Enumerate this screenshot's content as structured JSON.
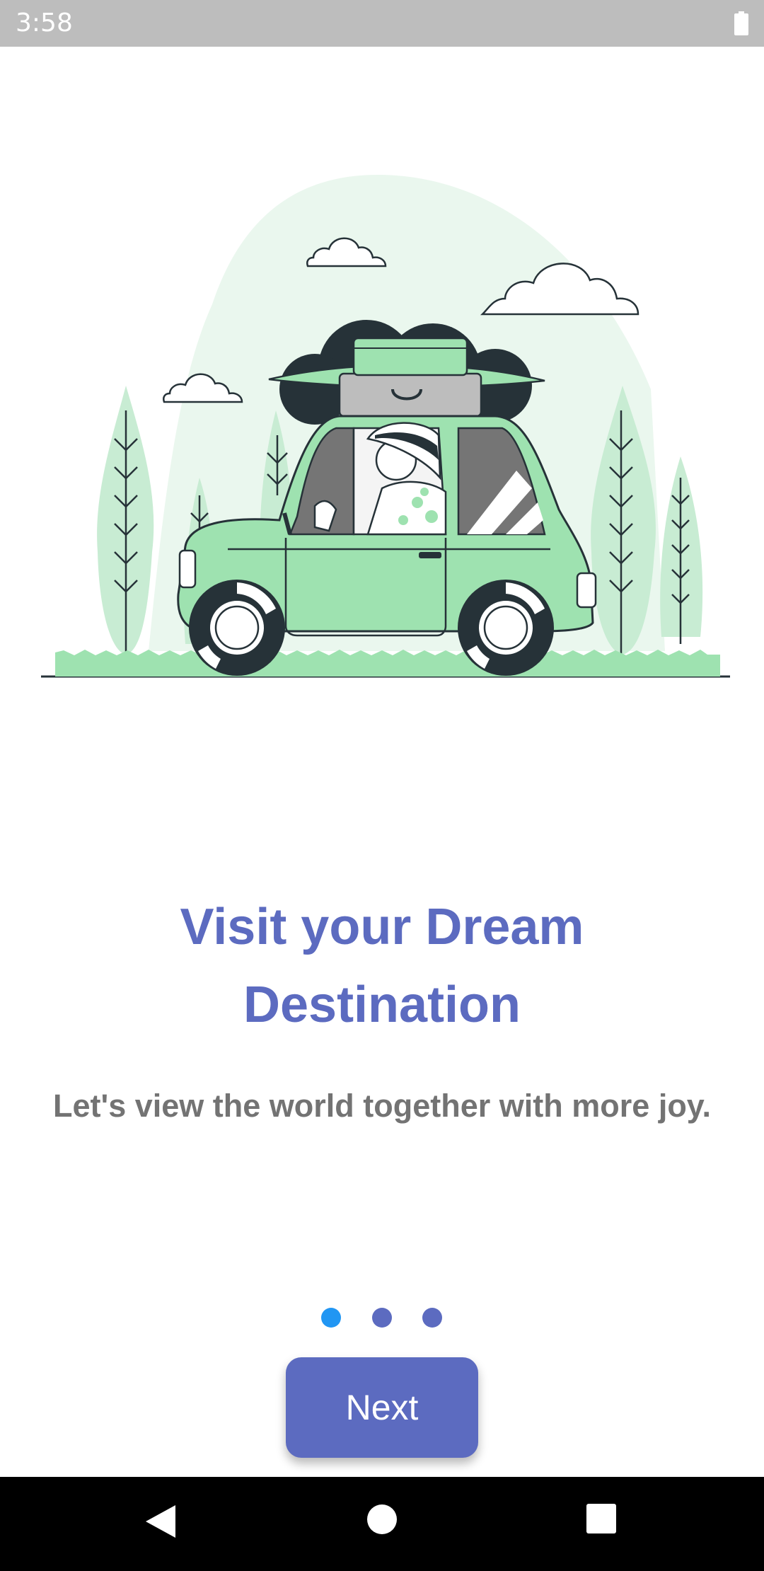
{
  "status_bar": {
    "time": "3:58",
    "icons": [
      "battery-icon"
    ]
  },
  "onboarding": {
    "title": "Visit your Dream Destination",
    "subtitle": "Let's view the world together with more joy.",
    "page_indicator": {
      "count": 3,
      "active_index": 0,
      "active_color": "#2196f3",
      "inactive_color": "#5c6bc0"
    },
    "next_label": "Next"
  },
  "illustration": {
    "subject": "car-trip-illustration",
    "accent_color": "#9ee2b0"
  },
  "nav_bar": {
    "icons": [
      "back-icon",
      "home-icon",
      "recents-icon"
    ]
  },
  "colors": {
    "primary": "#5c6bc0",
    "status_bar": "#bdbdbd",
    "nav_bar": "#000000"
  }
}
